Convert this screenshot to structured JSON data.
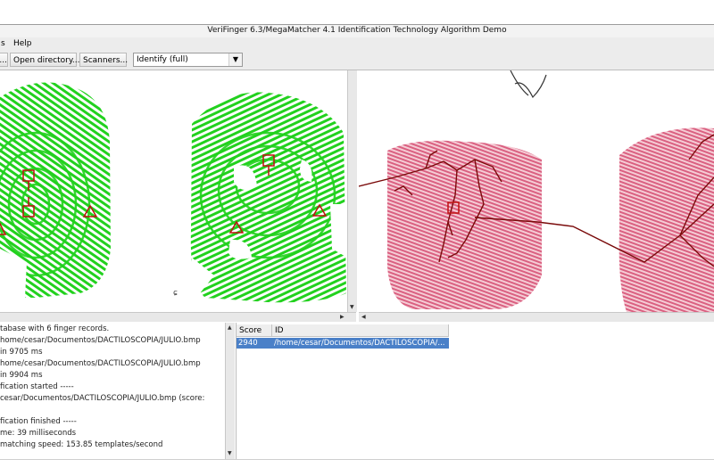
{
  "window": {
    "title": "VeriFinger 6.3/MegaMatcher 4.1 Identification Technology Algorithm Demo"
  },
  "menu": {
    "items": [
      {
        "label": "s"
      },
      {
        "label": "Help"
      }
    ]
  },
  "toolbar": {
    "partial_button": "...",
    "open_directory": "Open directory...",
    "scanners": "Scanners...",
    "mode_select": {
      "value": "Identify (full)"
    }
  },
  "log": {
    "lines": [
      "tabase with 6 finger records.",
      "home/cesar/Documentos/DACTILOSCOPIA/JULIO.bmp",
      "in 9705 ms",
      "home/cesar/Documentos/DACTILOSCOPIA/JULIO.bmp",
      "in 9904 ms",
      "fication started -----",
      "cesar/Documentos/DACTILOSCOPIA/JULIO.bmp (score:",
      "",
      "fication finished -----",
      "me: 39 milliseconds",
      "matching speed:   153.85 templates/second"
    ]
  },
  "results": {
    "columns": {
      "score": "Score",
      "id": "ID"
    },
    "rows": [
      {
        "score": "2940",
        "id": "/home/cesar/Documentos/DACTILOSCOPIA/..."
      }
    ]
  },
  "colors": {
    "ridge_green": "#22d11e",
    "print_red": "#d8587a",
    "minutia": "#c01010",
    "selection": "#4a80c8"
  }
}
